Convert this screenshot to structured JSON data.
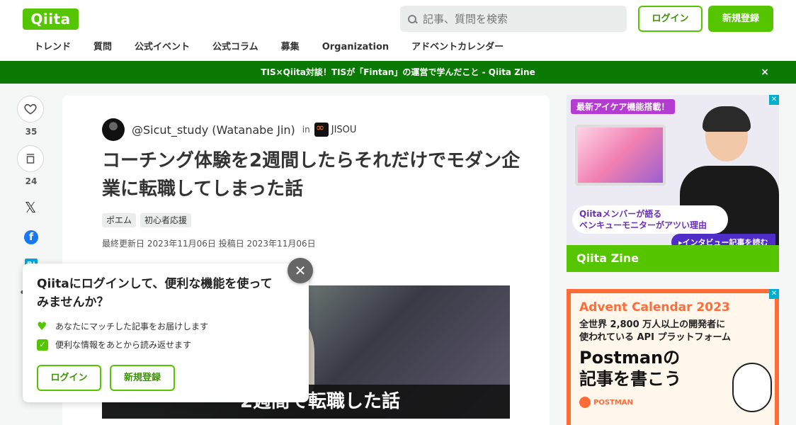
{
  "header": {
    "logo": "Qiita",
    "search_placeholder": "記事、質問を検索",
    "login_label": "ログイン",
    "signup_label": "新規登録",
    "nav": [
      "トレンド",
      "質問",
      "公式イベント",
      "公式コラム",
      "募集",
      "Organization",
      "アドベントカレンダー"
    ]
  },
  "banner": {
    "text": "TIS×Qiita対談！TISが「Fintan」の運営で学んだこと - Qiita Zine",
    "close": "×"
  },
  "actions": {
    "likes": "35",
    "stocks": "24"
  },
  "article": {
    "author": "@Sicut_study (Watanabe Jin)",
    "in_label": "in",
    "organization": "JISOU",
    "title": "コーチング体験を2週間したらそれだけでモダン企業に転職してしまった話",
    "tags": [
      "ポエム",
      "初心者応援"
    ],
    "dates": "最終更新日 2023年11月06日  投稿日 2023年11月06日",
    "hero_caption": "2週間で転職した話"
  },
  "popup": {
    "title": "Qiitaにログインして、便利な機能を使ってみませんか？",
    "benefits": [
      "あなたにマッチした記事をお届けします",
      "便利な情報をあとから読み返せます"
    ],
    "login_label": "ログイン",
    "signup_label": "新規登録",
    "close": "✕"
  },
  "ads": {
    "ad1_badge": "最新アイケア機能搭載！",
    "ad1_bubble_1": "Qiitaメンバーが語る",
    "ad1_bubble_2": "ベンキューモニターがアツい理由",
    "ad1_cta": "▸インタビュー記事を読む",
    "ad1_footer": "Qiita Zine",
    "ad2_title": "Advent Calendar 2023",
    "ad2_sub_1": "全世界 2,800 万人以上の開発者に",
    "ad2_sub_2": "使われている API プラットフォーム",
    "ad2_big_1": "Postmanの",
    "ad2_big_2": "記事を書こう",
    "ad2_brand": "POSTMAN"
  },
  "colors": {
    "brand_green": "#55c500",
    "banner_green": "#0a7a04",
    "postman_orange": "#ff6c37"
  }
}
